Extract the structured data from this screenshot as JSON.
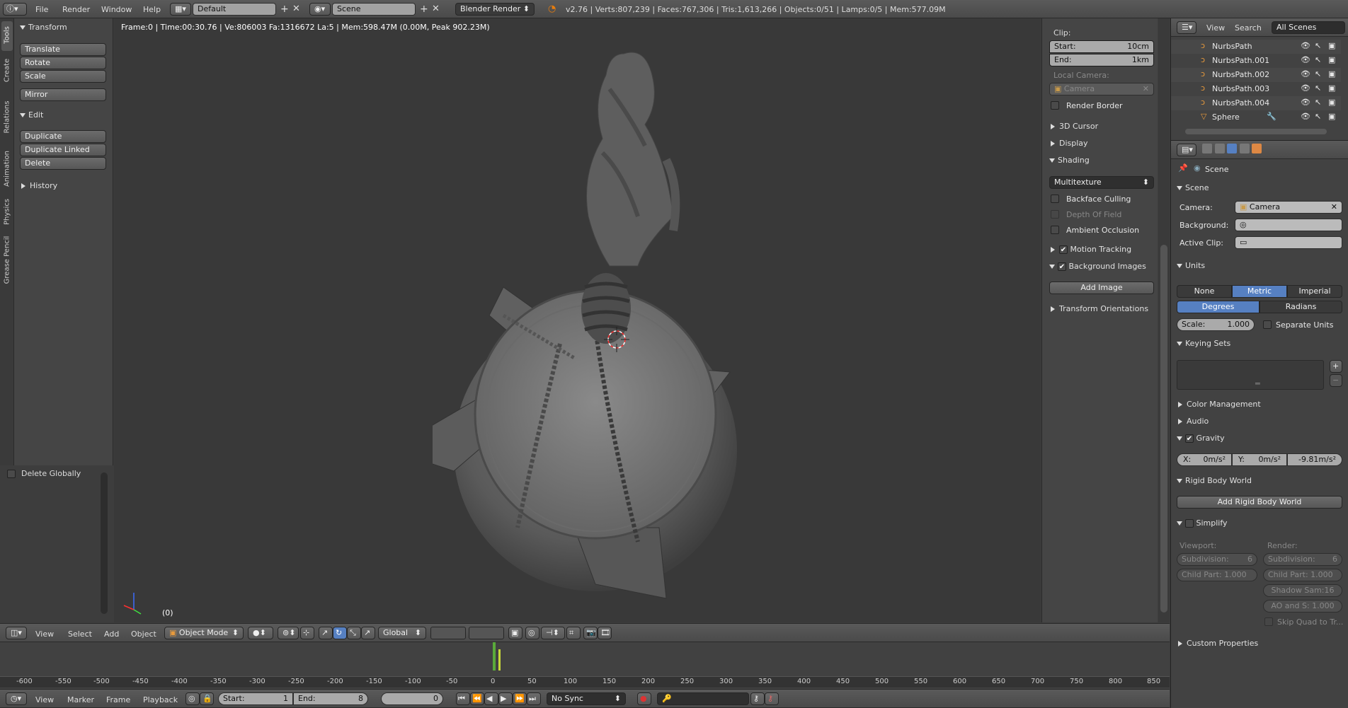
{
  "top_bar": {
    "menus": [
      "File",
      "Render",
      "Window",
      "Help"
    ],
    "layout": "Default",
    "scene": "Scene",
    "engine": "Blender Render",
    "stats": "v2.76 | Verts:807,239 | Faces:767,306 | Tris:1,613,266 | Objects:0/51 | Lamps:0/5 | Mem:577.09M"
  },
  "left_tabs": [
    "Tools",
    "Create",
    "Relations",
    "Animation",
    "Physics",
    "Grease Pencil"
  ],
  "tool_shelf": {
    "transform_title": "Transform",
    "transform_buttons": [
      "Translate",
      "Rotate",
      "Scale"
    ],
    "mirror": "Mirror",
    "edit_title": "Edit",
    "edit_buttons": [
      "Duplicate",
      "Duplicate Linked",
      "Delete"
    ],
    "history_title": "History",
    "delete_globally": "Delete Globally"
  },
  "viewport": {
    "info": "Frame:0 | Time:00:30.76 | Ve:806003 Fa:1316672 La:5 | Mem:598.47M (0.00M, Peak 902.23M)",
    "frame_label": "(0)"
  },
  "properties_panel": {
    "clip_label": "Clip:",
    "clip_start_label": "Start:",
    "clip_start": "10cm",
    "clip_end_label": "End:",
    "clip_end": "1km",
    "local_camera": "Local Camera:",
    "camera_field": "Camera",
    "render_border": "Render Border",
    "cursor": "3D Cursor",
    "display": "Display",
    "shading": "Shading",
    "shading_mode": "Multitexture",
    "backface": "Backface Culling",
    "dof": "Depth Of Field",
    "ao": "Ambient Occlusion",
    "motion": "Motion Tracking",
    "bg_images": "Background Images",
    "add_image": "Add Image",
    "transform_orient": "Transform Orientations"
  },
  "outliner": {
    "menus": [
      "View",
      "Search"
    ],
    "filter": "All Scenes",
    "items": [
      "NurbsPath",
      "NurbsPath.001",
      "NurbsPath.002",
      "NurbsPath.003",
      "NurbsPath.004",
      "Sphere"
    ]
  },
  "scene_props": {
    "breadcrumb": "Scene",
    "scene_title": "Scene",
    "camera_label": "Camera:",
    "camera_value": "Camera",
    "background_label": "Background:",
    "clip_label": "Active Clip:",
    "units_title": "Units",
    "units": [
      "None",
      "Metric",
      "Imperial"
    ],
    "angle": [
      "Degrees",
      "Radians"
    ],
    "scale_label": "Scale:",
    "scale_value": "1.000",
    "separate_units": "Separate Units",
    "keying_title": "Keying Sets",
    "color_mgmt": "Color Management",
    "audio": "Audio",
    "gravity": "Gravity",
    "grav_x_label": "X:",
    "grav_x": "0m/s²",
    "grav_y_label": "Y:",
    "grav_y": "0m/s²",
    "grav_z": "-9.81m/s²",
    "rigid_body": "Rigid Body World",
    "add_rigid": "Add Rigid Body World",
    "simplify": "Simplify",
    "viewport_label": "Viewport:",
    "render_label": "Render:",
    "subdivision_label": "Subdivision:",
    "subdivision_v": "6",
    "subdivision_r": "6",
    "child_part_label": "Child Part:",
    "child_part_v": "1.000",
    "child_part_r": "1.000",
    "shadow_sam": "Shadow Sam:16",
    "ao_s": "AO and S: 1.000",
    "skip_quad": "Skip Quad to Tr...",
    "custom_props": "Custom Properties"
  },
  "view3d_header": {
    "menus": [
      "View",
      "Select",
      "Add",
      "Object"
    ],
    "mode": "Object Mode",
    "orientation": "Global"
  },
  "timeline": {
    "ticks": [
      "-600",
      "-550",
      "-500",
      "-450",
      "-400",
      "-350",
      "-300",
      "-250",
      "-200",
      "-150",
      "-100",
      "-50",
      "0",
      "50",
      "100",
      "150",
      "200",
      "250",
      "300",
      "350",
      "400",
      "450",
      "500",
      "550",
      "600",
      "650",
      "700",
      "750",
      "800",
      "850"
    ],
    "menus": [
      "View",
      "Marker",
      "Frame",
      "Playback"
    ],
    "start_label": "Start:",
    "start": "1",
    "end_label": "End:",
    "end": "8",
    "current": "0",
    "sync": "No Sync"
  }
}
